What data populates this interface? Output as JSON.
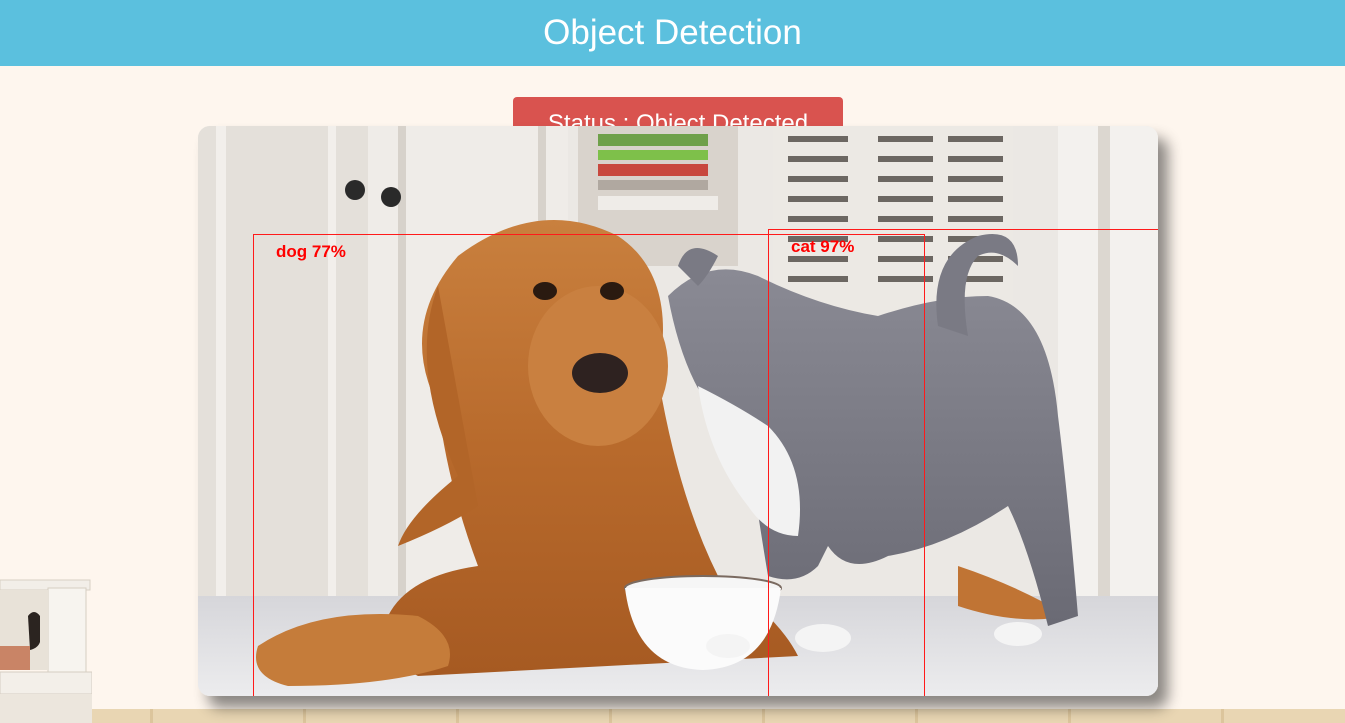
{
  "header": {
    "title": "Object Detection"
  },
  "status": {
    "label": "Status : Object Detected"
  },
  "detections": [
    {
      "label": "dog 77%"
    },
    {
      "label": "cat 97%"
    }
  ],
  "colors": {
    "header_bg": "#5bc0de",
    "status_bg": "#d9534f",
    "box_color": "#ff0000",
    "page_bg": "#fef6ee"
  }
}
